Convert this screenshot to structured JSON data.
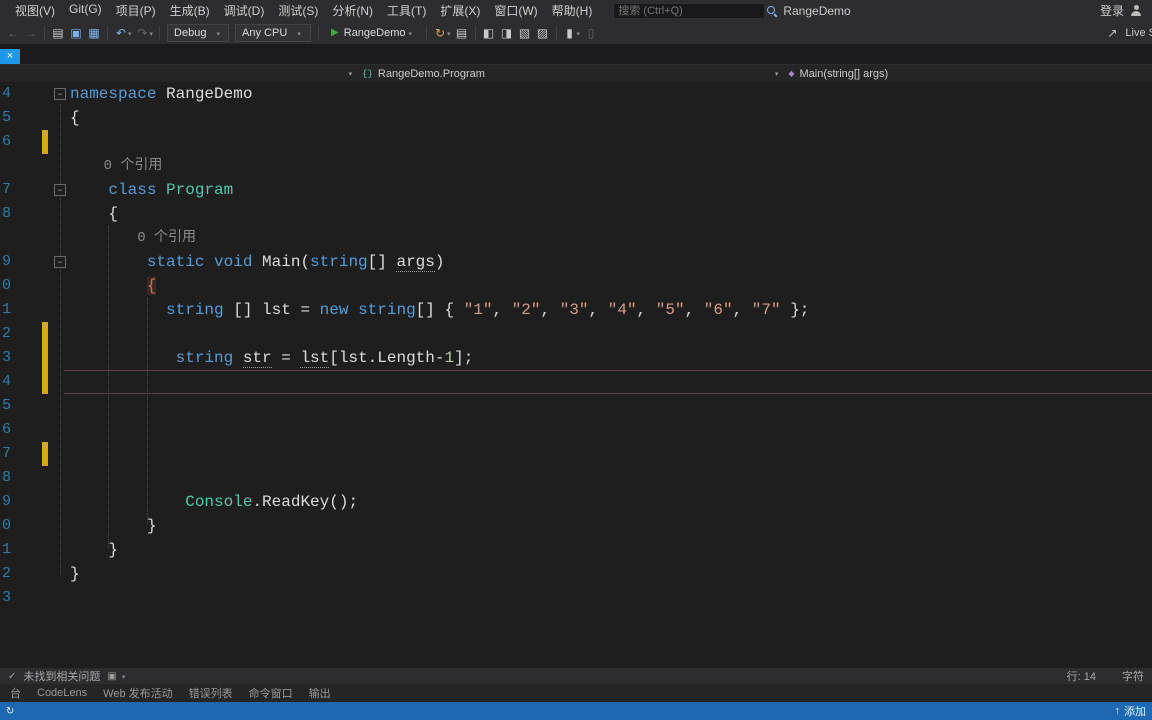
{
  "menu_bar": {
    "items": [
      "视图(V)",
      "Git(G)",
      "项目(P)",
      "生成(B)",
      "调试(D)",
      "测试(S)",
      "分析(N)",
      "工具(T)",
      "扩展(X)",
      "窗口(W)",
      "帮助(H)"
    ],
    "search_placeholder": "搜索 (Ctrl+Q)",
    "window_title": "RangeDemo",
    "sign_in_label": "登录"
  },
  "toolbar": {
    "configuration": "Debug",
    "platform": "Any CPU",
    "run_label": "RangeDemo",
    "live_share_label": "Live Share"
  },
  "icons": {
    "back": "←",
    "forward": "→",
    "new-file": "▤",
    "save": "▣",
    "save-all": "▦",
    "undo": "↶",
    "redo": "↷",
    "caret": "▾",
    "play": "▶",
    "close": "×",
    "hot-reload": "↻",
    "list": "▤",
    "indent-decrease": "◧",
    "indent-increase": "◨",
    "comment": "▧",
    "uncomment": "▨",
    "bookmark": "▮",
    "bookmark-list": "▯",
    "share": "↗",
    "arrow-up": "↑",
    "check": "✓",
    "camera": "▣",
    "minus": "−",
    "class": "{}",
    "method": "◆"
  },
  "breadcrumb": {
    "project_label": "",
    "type_label": "RangeDemo.Program",
    "member_label": "Main(string[] args)"
  },
  "editor": {
    "rows": [
      {
        "digit": "4",
        "fold": true,
        "indent": 0,
        "segments": [
          {
            "t": "namespace",
            "c": "kw"
          },
          {
            "t": " RangeDemo",
            "c": "pl"
          }
        ]
      },
      {
        "digit": "5",
        "indent": 0,
        "segments": [
          {
            "t": "{",
            "c": "pl"
          }
        ]
      },
      {
        "digit": "6",
        "changed": true,
        "segments": []
      },
      {
        "lens": true,
        "indent": 4,
        "text": "0 个引用"
      },
      {
        "digit": "7",
        "fold": true,
        "indent": 4,
        "segments": [
          {
            "t": "class",
            "c": "kw"
          },
          {
            "t": " ",
            "c": "pl"
          },
          {
            "t": "Program",
            "c": "ty"
          }
        ]
      },
      {
        "digit": "8",
        "indent": 4,
        "segments": [
          {
            "t": "{",
            "c": "pl"
          }
        ]
      },
      {
        "lens": true,
        "indent": 8,
        "text": "0 个引用"
      },
      {
        "digit": "9",
        "fold": true,
        "indent": 8,
        "segments": [
          {
            "t": "static",
            "c": "kw"
          },
          {
            "t": " ",
            "c": "pl"
          },
          {
            "t": "void",
            "c": "kw"
          },
          {
            "t": " Main(",
            "c": "pl"
          },
          {
            "t": "string",
            "c": "kw"
          },
          {
            "t": "[] ",
            "c": "pl"
          },
          {
            "t": "args",
            "c": "pl",
            "u": true
          },
          {
            "t": ")",
            "c": "pl"
          }
        ]
      },
      {
        "digit": "0",
        "indent": 8,
        "segments": [
          {
            "t": "{",
            "c": "bh"
          }
        ]
      },
      {
        "digit": "1",
        "indent": 10,
        "segments": [
          {
            "t": "string",
            "c": "kw"
          },
          {
            "t": " [] lst = ",
            "c": "pl"
          },
          {
            "t": "new",
            "c": "kw"
          },
          {
            "t": " ",
            "c": "pl"
          },
          {
            "t": "string",
            "c": "kw"
          },
          {
            "t": "[] { ",
            "c": "pl"
          },
          {
            "t": "\"1\"",
            "c": "str"
          },
          {
            "t": ", ",
            "c": "pl"
          },
          {
            "t": "\"2\"",
            "c": "str"
          },
          {
            "t": ", ",
            "c": "pl"
          },
          {
            "t": "\"3\"",
            "c": "str"
          },
          {
            "t": ", ",
            "c": "pl"
          },
          {
            "t": "\"4\"",
            "c": "str"
          },
          {
            "t": ", ",
            "c": "pl"
          },
          {
            "t": "\"5\"",
            "c": "str"
          },
          {
            "t": ", ",
            "c": "pl"
          },
          {
            "t": "\"6\"",
            "c": "str"
          },
          {
            "t": ", ",
            "c": "pl"
          },
          {
            "t": "\"7\"",
            "c": "str"
          },
          {
            "t": " };",
            "c": "pl"
          }
        ]
      },
      {
        "digit": "2",
        "changed": true,
        "segments": []
      },
      {
        "digit": "3",
        "changed": true,
        "indent": 11,
        "segments": [
          {
            "t": "string",
            "c": "kw"
          },
          {
            "t": " ",
            "c": "pl"
          },
          {
            "t": "str",
            "c": "pl",
            "u": true
          },
          {
            "t": " = ",
            "c": "pl"
          },
          {
            "t": "lst",
            "c": "pl",
            "u": true
          },
          {
            "t": "[lst.Length-",
            "c": "pl"
          },
          {
            "t": "1",
            "c": "num"
          },
          {
            "t": "];",
            "c": "pl"
          }
        ]
      },
      {
        "digit": "4",
        "changed": true,
        "current": true,
        "segments": []
      },
      {
        "digit": "5",
        "segments": []
      },
      {
        "digit": "6",
        "segments": []
      },
      {
        "digit": "7",
        "changed": true,
        "segments": []
      },
      {
        "digit": "8",
        "segments": []
      },
      {
        "digit": "9",
        "indent": 12,
        "segments": [
          {
            "t": "Console",
            "c": "ty"
          },
          {
            "t": ".ReadKey();",
            "c": "pl"
          }
        ]
      },
      {
        "digit": "0",
        "indent": 8,
        "segments": [
          {
            "t": "}",
            "c": "pl"
          }
        ]
      },
      {
        "digit": "1",
        "indent": 4,
        "segments": [
          {
            "t": "}",
            "c": "pl"
          }
        ]
      },
      {
        "digit": "2",
        "indent": 0,
        "segments": [
          {
            "t": "}",
            "c": "pl"
          }
        ]
      },
      {
        "digit": "3",
        "segments": []
      }
    ]
  },
  "health_bar": {
    "message": "未找到相关问题",
    "line_label": "行: 14",
    "char_label": "字符"
  },
  "panel_tabs": [
    "台",
    "CodeLens",
    "Web 发布活动",
    "错误列表",
    "命令窗口",
    "输出"
  ],
  "status_bar": {
    "source_control_label": "添加"
  }
}
